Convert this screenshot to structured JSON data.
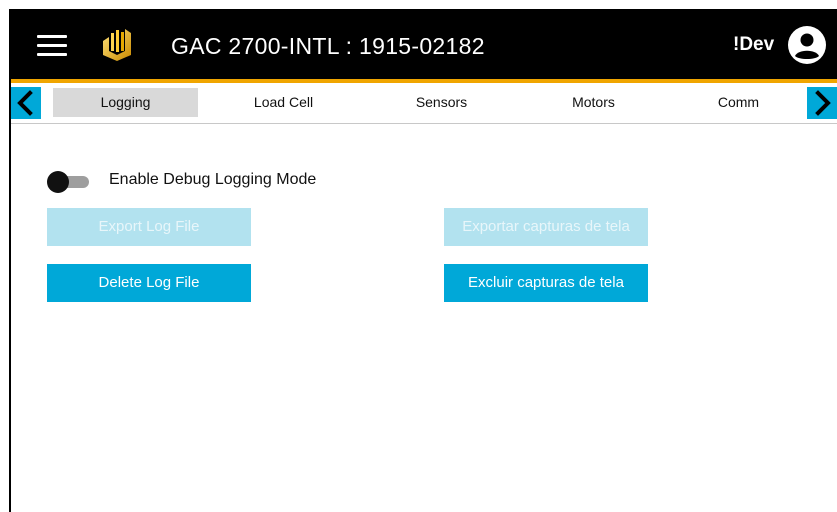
{
  "header": {
    "title": "GAC 2700-INTL : 1915-02182",
    "dev_label": "!Dev",
    "menu_icon": "hamburger-menu-icon",
    "logo_icon": "logo-icon",
    "account_icon": "account-circle-icon"
  },
  "colors": {
    "topbar": "#000000",
    "accent": "#f0a500",
    "primary": "#00a8d8",
    "primary_disabled": "#b2e2ef",
    "active_tab": "#d9d9d9"
  },
  "tabs": [
    {
      "label": "Logging",
      "active": true
    },
    {
      "label": "Load Cell",
      "active": false
    },
    {
      "label": "Sensors",
      "active": false
    },
    {
      "label": "Motors",
      "active": false
    },
    {
      "label": "Comm",
      "active": false
    }
  ],
  "logging": {
    "debug_toggle_label": "Enable Debug Logging Mode",
    "debug_toggle_on": false,
    "export_log_label": "Export Log File",
    "delete_log_label": "Delete Log File",
    "export_screenshots_label": "Exportar capturas de tela",
    "delete_screenshots_label": "Excluir capturas de tela"
  }
}
